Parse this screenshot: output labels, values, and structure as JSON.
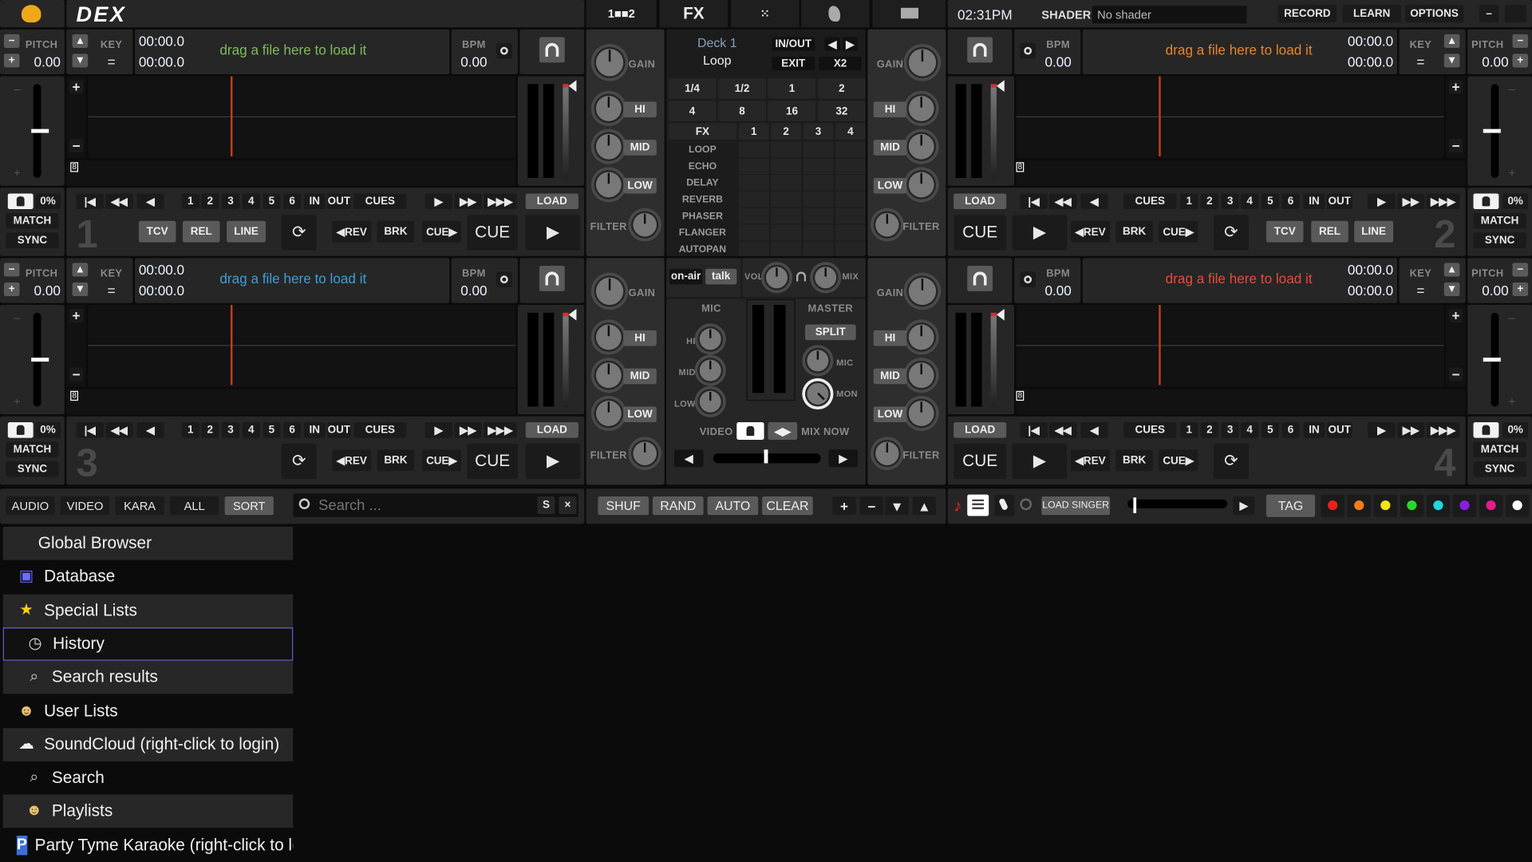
{
  "app": {
    "logo": "DEX",
    "time": "02:31PM",
    "shader_label": "SHADER",
    "shader_value": "No shader",
    "record": "RECORD",
    "learn": "LEARN",
    "options": "OPTIONS",
    "minimize": "–",
    "maximize": ""
  },
  "center_tabs": {
    "decks": "1■■2",
    "fx": "FX",
    "grid": "⁙",
    "dancer": "",
    "video": ""
  },
  "deck_labels": {
    "pitch": "PITCH",
    "key": "KEY",
    "bpm": "BPM",
    "minus": "−",
    "plus": "+",
    "up": "▲",
    "down": "▼",
    "fader_minus": "–",
    "fader_plus": "+"
  },
  "decks": [
    {
      "number": "1",
      "pitch": "0.00",
      "key": "=",
      "time_elapsed": "00:00.0",
      "time_remaining": "00:00.0",
      "bpm": "0.00",
      "drop_text": "drag a file here to load it",
      "drop_color": "#7dbd5a",
      "pitch_range": "0%",
      "beat_marker": "8",
      "timecode": true
    },
    {
      "number": "2",
      "pitch": "0.00",
      "key": "=",
      "time_elapsed": "00:00.0",
      "time_remaining": "00:00.0",
      "bpm": "0.00",
      "drop_text": "drag a file here to load it",
      "drop_color": "#e8852a",
      "pitch_range": "0%",
      "beat_marker": "8",
      "timecode": true
    },
    {
      "number": "3",
      "pitch": "0.00",
      "key": "=",
      "time_elapsed": "00:00.0",
      "time_remaining": "00:00.0",
      "bpm": "0.00",
      "drop_text": "drag a file here to load it",
      "drop_color": "#3aa0d8",
      "pitch_range": "0%",
      "beat_marker": "8",
      "timecode": false
    },
    {
      "number": "4",
      "pitch": "0.00",
      "key": "=",
      "time_elapsed": "00:00.0",
      "time_remaining": "00:00.0",
      "bpm": "0.00",
      "drop_text": "drag a file here to load it",
      "drop_color": "#e84a3a",
      "pitch_range": "0%",
      "beat_marker": "8",
      "timecode": false
    }
  ],
  "transport": {
    "start": "|◀",
    "rewind": "◀◀",
    "back": "◀",
    "hotcues": [
      "1",
      "2",
      "3",
      "4",
      "5",
      "6"
    ],
    "in": "IN",
    "out": "OUT",
    "cues": "CUES",
    "forward": "▶",
    "fast_forward": "▶▶",
    "fastest": "▶▶▶",
    "load": "LOAD",
    "match": "MATCH",
    "sync": "SYNC",
    "tcv": "TCV",
    "rel": "REL",
    "line": "LINE",
    "rev": "◀REV",
    "brk": "BRK",
    "cue_forward": "CUE▶",
    "cue": "CUE",
    "play": "▶",
    "loop_icon": "⟳"
  },
  "mixer": {
    "gain": "GAIN",
    "hi": "HI",
    "mid": "MID",
    "low": "LOW",
    "filter": "FILTER"
  },
  "fx_panel": {
    "deck": "Deck 1",
    "mode": "Loop",
    "inout": "IN/OUT",
    "prev": "◀",
    "next": "▶",
    "exit": "EXIT",
    "x2": "X2",
    "loop_sizes": [
      "1/4",
      "1/2",
      "1",
      "2",
      "4",
      "8",
      "16",
      "32"
    ],
    "fx_header": "FX",
    "slots": [
      "1",
      "2",
      "3",
      "4"
    ],
    "effects": [
      "LOOP",
      "ECHO",
      "DELAY",
      "REVERB",
      "PHASER",
      "FLANGER",
      "AUTOPAN"
    ]
  },
  "mic": {
    "on_air": "on-air",
    "talk": "talk",
    "vol": "VOL",
    "mix": "MIX",
    "mic": "MIC",
    "hi": "HI",
    "mid": "MID",
    "low": "LOW",
    "master": "MASTER",
    "split": "SPLIT",
    "master_mic": "MIC",
    "mon": "MON",
    "video": "VIDEO",
    "swap": "◀▶",
    "mix_now": "MIX NOW",
    "xf_left": "◀",
    "xf_right": "▶"
  },
  "toolbar_left": {
    "tabs": [
      "AUDIO",
      "VIDEO",
      "KARA",
      "ALL",
      "SORT"
    ],
    "active_tab": "SORT",
    "search_placeholder": "Search ...",
    "search_s": "S",
    "search_clear": "×"
  },
  "toolbar_center": {
    "buttons": [
      "SHUF",
      "RAND",
      "AUTO",
      "CLEAR"
    ],
    "add": "+",
    "remove": "−",
    "down": "▼",
    "up": "▲"
  },
  "toolbar_right": {
    "note": "♪",
    "load_singer": "LOAD SINGER",
    "play": "▶",
    "tag": "TAG",
    "colors": [
      "#e8231b",
      "#f07d1a",
      "#f2e21a",
      "#2bd62b",
      "#22d6e0",
      "#8a1ee0",
      "#e81c8c",
      "#ffffff"
    ]
  },
  "browser": {
    "items": [
      {
        "label": "Global Browser",
        "icon": "none",
        "selected": false
      },
      {
        "label": "Database",
        "icon": "database-icon",
        "selected": false
      },
      {
        "label": "Special Lists",
        "icon": "star-icon",
        "selected": false
      },
      {
        "label": "History",
        "icon": "clock-icon",
        "selected": true
      },
      {
        "label": "Search results",
        "icon": "search-icon",
        "selected": false
      },
      {
        "label": "User Lists",
        "icon": "user-icon",
        "selected": false
      },
      {
        "label": "SoundCloud (right-click to login)",
        "icon": "cloud-icon",
        "selected": false
      },
      {
        "label": "Search",
        "icon": "search-icon",
        "selected": false
      },
      {
        "label": "Playlists",
        "icon": "user-icon",
        "selected": false
      },
      {
        "label": "Party Tyme Karaoke (right-click to login)",
        "icon": "party-tyme-icon",
        "selected": false
      }
    ]
  }
}
